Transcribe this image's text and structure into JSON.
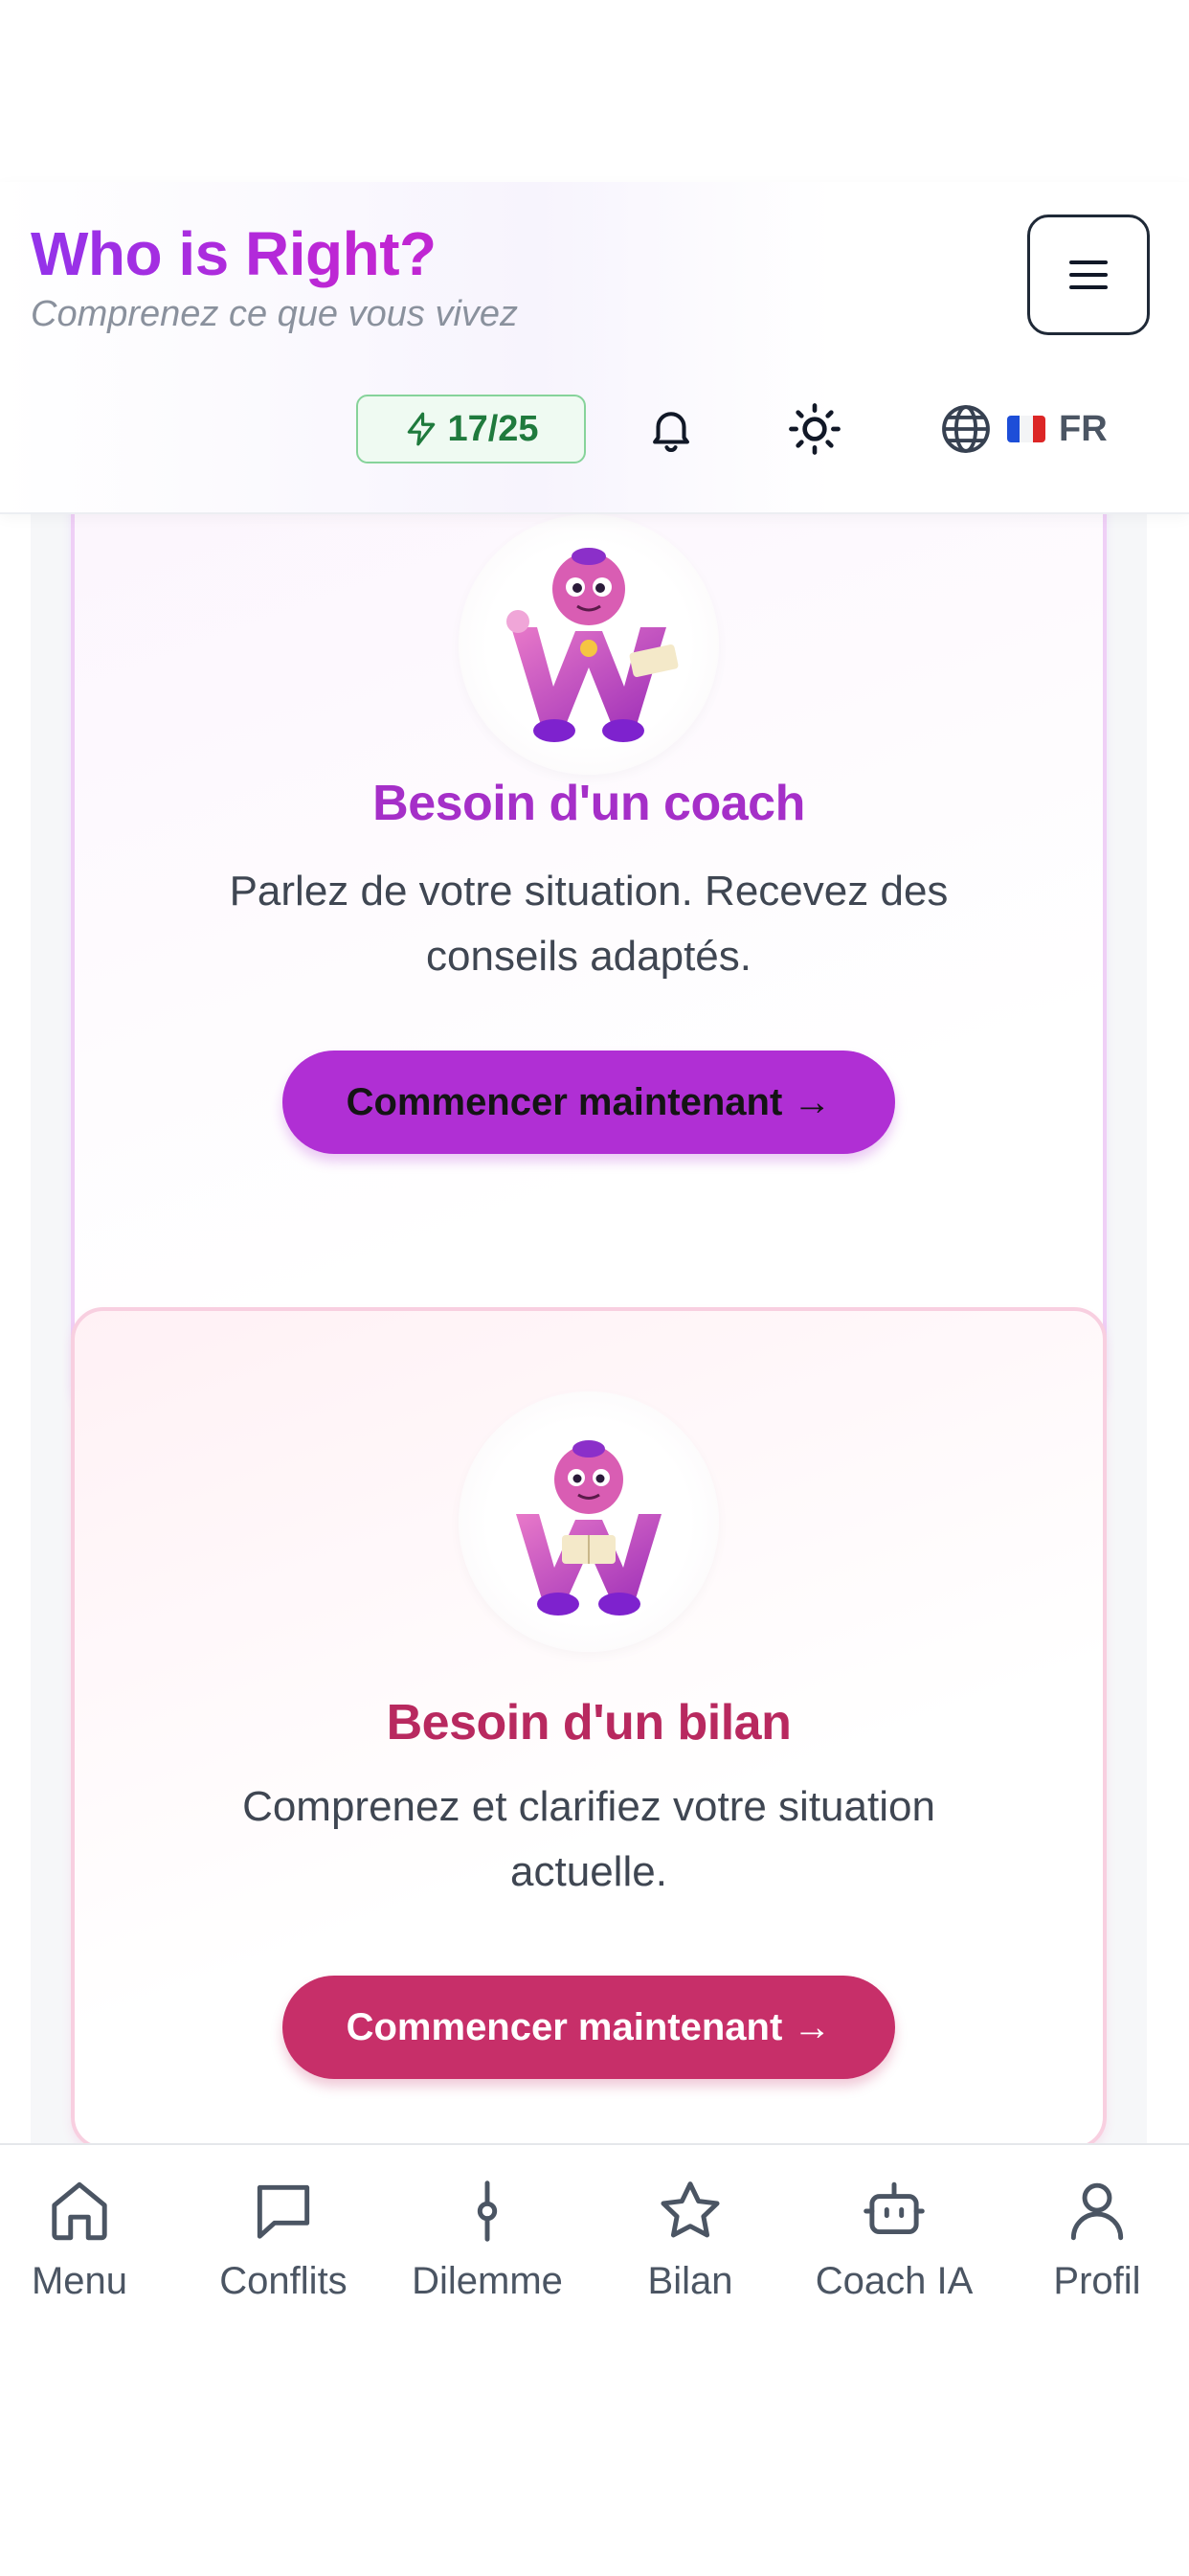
{
  "app": {
    "title": "Who is Right?",
    "subtitle": "Comprenez ce que vous vivez"
  },
  "header": {
    "menu_icon": "hamburger-icon",
    "credits": {
      "icon": "lightning-icon",
      "used": 17,
      "total": 25,
      "label": "17/25"
    },
    "notifications_icon": "bell-icon",
    "theme_icon": "sun-icon",
    "language": {
      "icon": "globe-icon",
      "flag": "french-flag",
      "code": "FR"
    }
  },
  "cards": [
    {
      "title": "Besoin d'un coach",
      "description": "Parlez de votre situation. Recevez des conseils adaptés.",
      "button": "Commencer maintenant →",
      "accent": "#a52fc8",
      "button_color": "#b02fd4"
    },
    {
      "title": "Besoin d'un bilan",
      "description": "Comprenez et clarifiez votre situation actuelle.",
      "button": "Commencer maintenant →",
      "accent": "#b8295f",
      "button_color": "#c72f69"
    }
  ],
  "nav": [
    {
      "label": "Menu",
      "icon": "home-icon"
    },
    {
      "label": "Conflits",
      "icon": "chat-icon"
    },
    {
      "label": "Dilemme",
      "icon": "scale-icon"
    },
    {
      "label": "Bilan",
      "icon": "star-icon"
    },
    {
      "label": "Coach IA",
      "icon": "robot-icon"
    },
    {
      "label": "Profil",
      "icon": "user-icon"
    }
  ],
  "colors": {
    "brand_purple": "#9333ea",
    "brand_magenta": "#c026d3",
    "credits_green": "#1f7a3d"
  }
}
